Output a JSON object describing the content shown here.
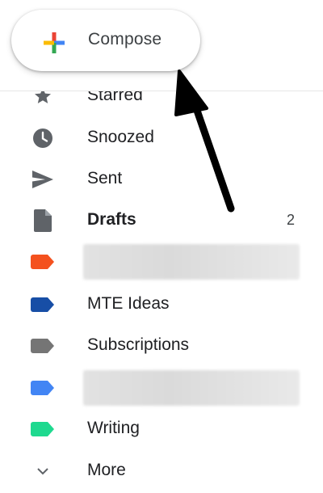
{
  "compose": {
    "label": "Compose"
  },
  "nav": {
    "items": [
      {
        "label": "Starred",
        "icon": "star-icon"
      },
      {
        "label": "Snoozed",
        "icon": "clock-icon"
      },
      {
        "label": "Sent",
        "icon": "send-icon"
      },
      {
        "label": "Drafts",
        "icon": "draft-icon",
        "count": "2"
      },
      {
        "label": "",
        "icon": "label-icon",
        "color": "#f4511e",
        "redacted": true
      },
      {
        "label": "MTE Ideas",
        "icon": "label-icon",
        "color": "#174ea6"
      },
      {
        "label": "Subscriptions",
        "icon": "label-icon",
        "color": "#757575"
      },
      {
        "label": "",
        "icon": "label-icon",
        "color": "#4285f4",
        "redacted": true
      },
      {
        "label": "Writing",
        "icon": "label-icon",
        "color": "#1ed98f"
      },
      {
        "label": "More",
        "icon": "chevron-down-icon"
      }
    ]
  },
  "colors": {
    "icon_gray": "#5f6368",
    "compose_plus": [
      "#ea4335",
      "#fbbc04",
      "#34a853",
      "#4285f4"
    ],
    "arrow": "#000000"
  }
}
